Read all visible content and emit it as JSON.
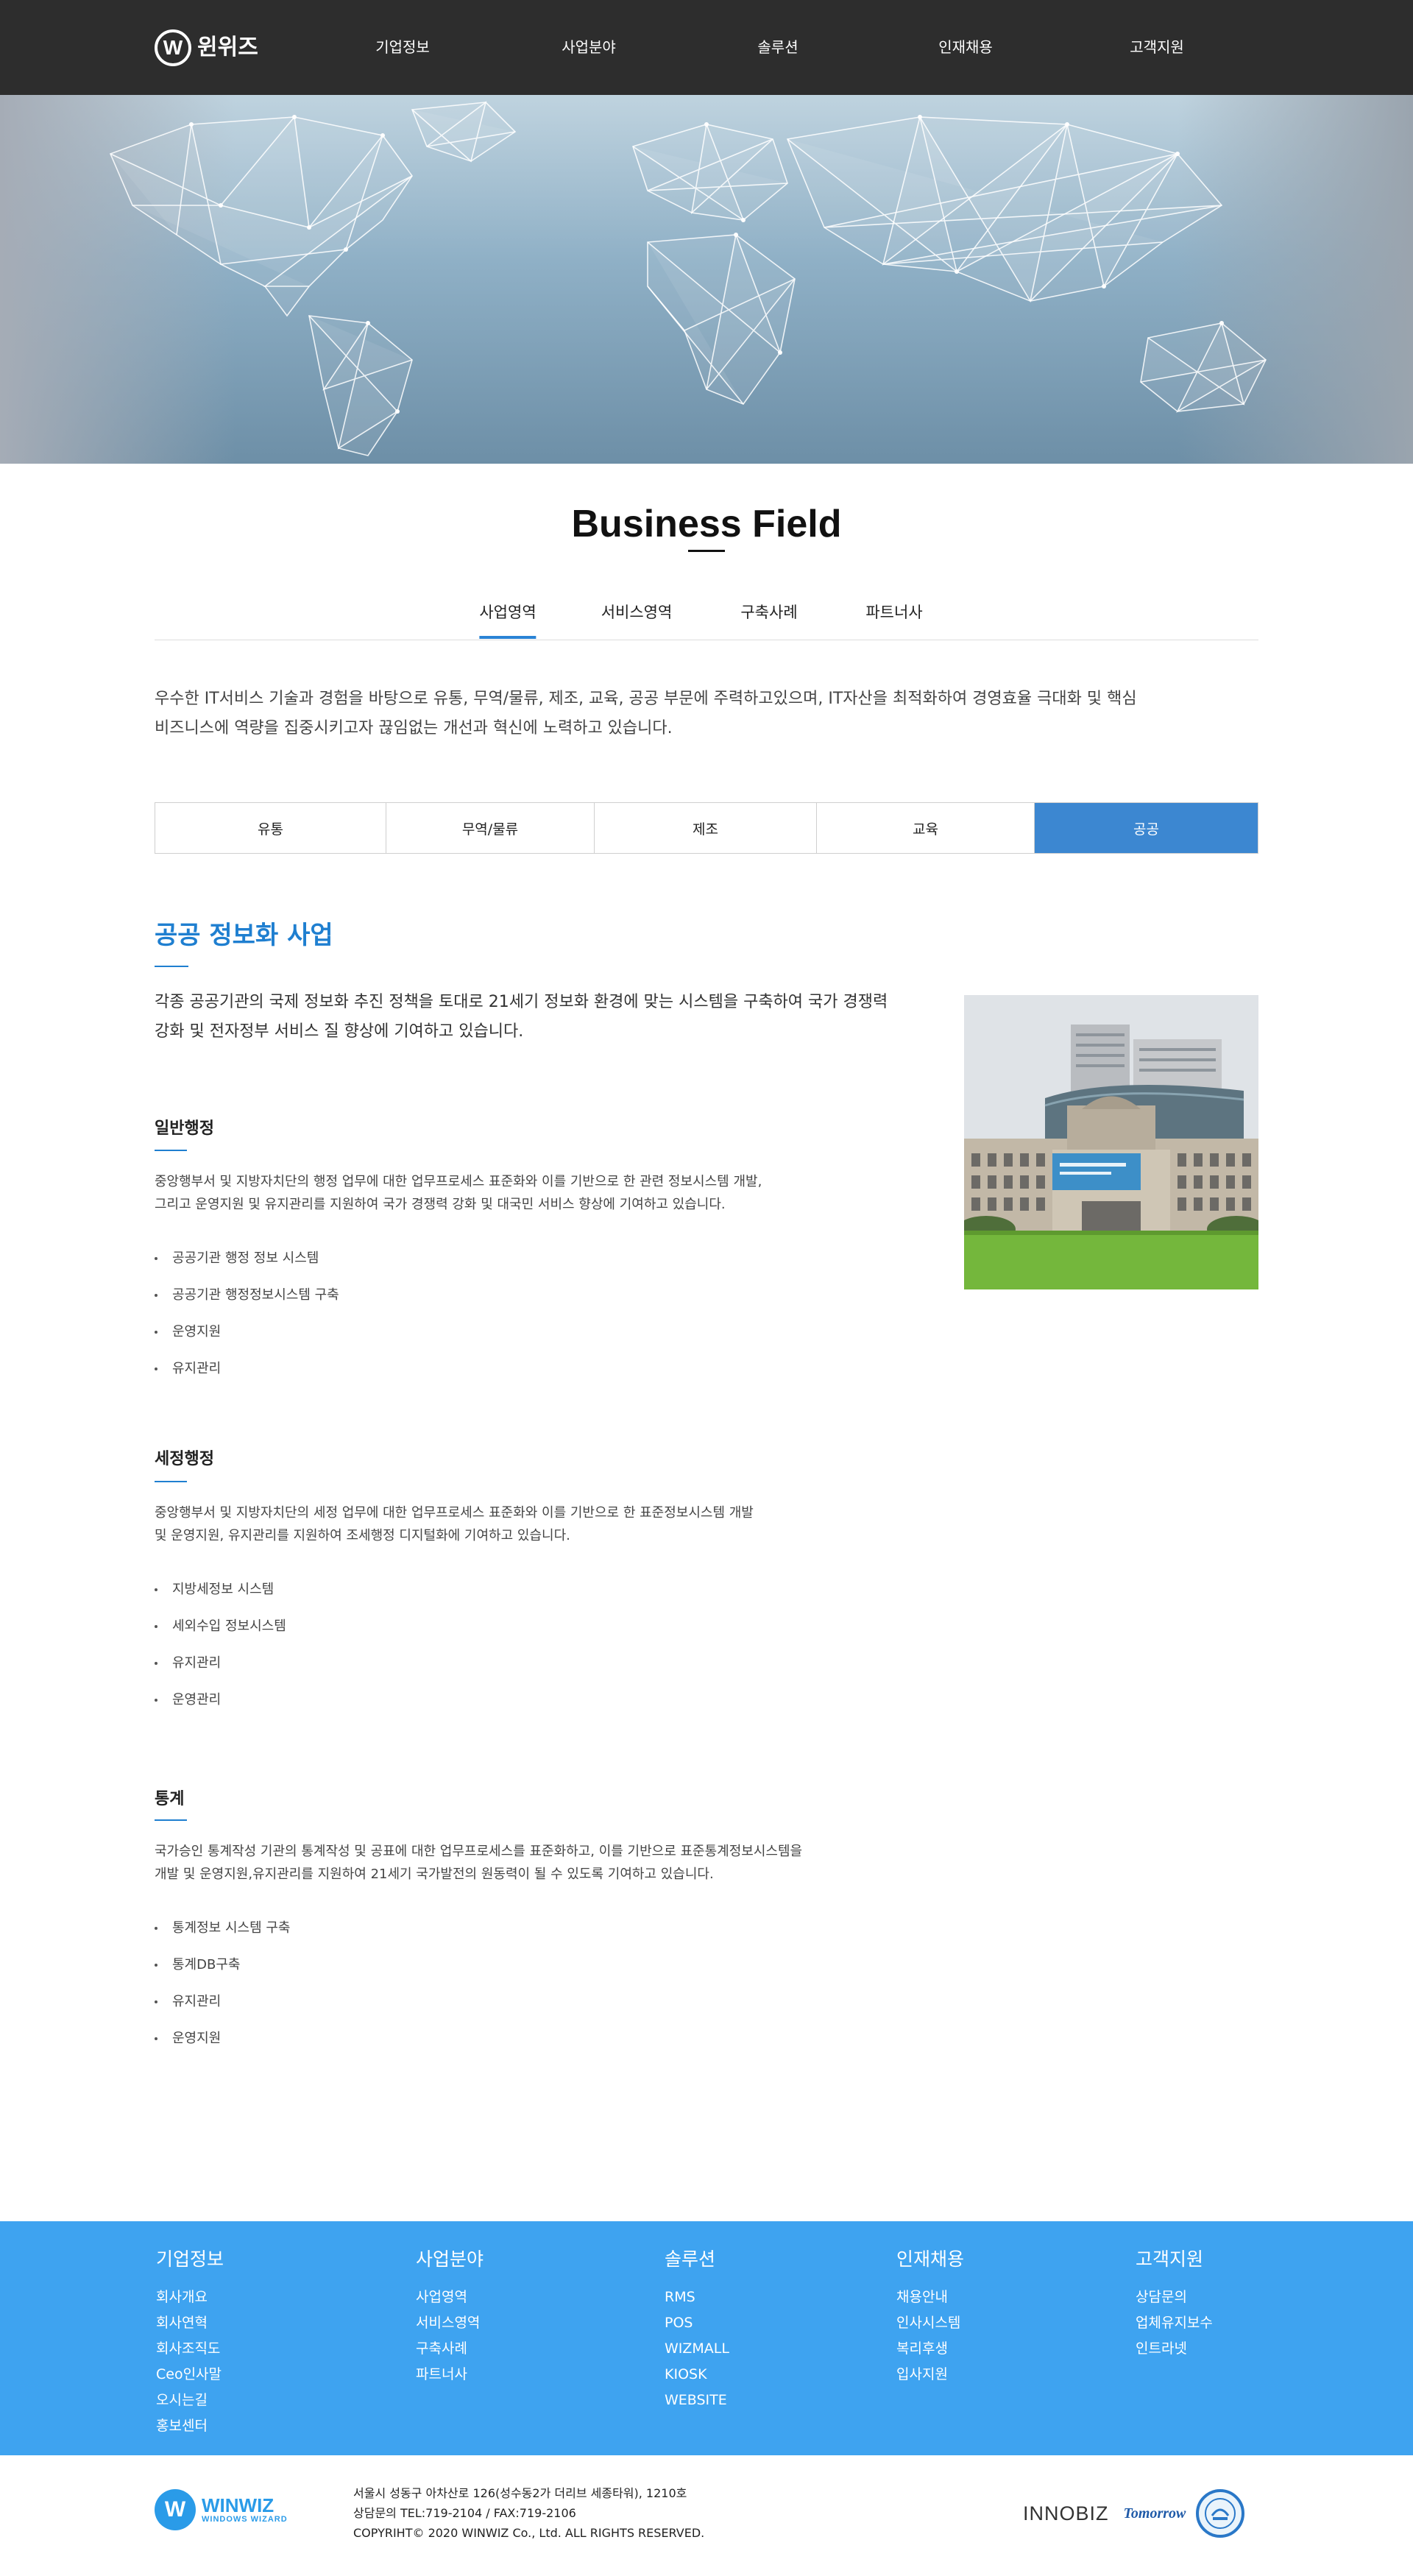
{
  "header": {
    "logo_text": "윈위즈",
    "logo_letter": "W",
    "nav": [
      "기업정보",
      "사업분야",
      "솔루션",
      "인재채용",
      "고객지원"
    ]
  },
  "page": {
    "title": "Business Field",
    "tabs": [
      "사업영역",
      "서비스영역",
      "구축사례",
      "파트너사"
    ],
    "active_tab": "사업영역",
    "intro_line1": "우수한 IT서비스 기술과 경험을 바탕으로 유통, 무역/물류, 제조, 교육, 공공 부문에 주력하고있으며, IT자산을 최적화하여 경영효율 극대화 및 핵심",
    "intro_line2": "비즈니스에 역량을 집중시키고자 끊임없는 개선과 혁신에 노력하고 있습니다."
  },
  "categories": [
    "유통",
    "무역/물류",
    "제조",
    "교육",
    "공공"
  ],
  "active_category": "공공",
  "section": {
    "title": "공공 정보화 사업",
    "desc_line1": "각종 공공기관의 국제 정보화 추진 정책을 토대로 21세기 정보화 환경에 맞는 시스템을 구축하여 국가 경쟁력",
    "desc_line2": "강화 및 전자정부 서비스 질 향상에 기여하고 있습니다.",
    "blocks": [
      {
        "title": "일반행정",
        "desc_line1": "중앙행부서 및 지방자치단의 행정 업무에 대한 업무프로세스 표준화와 이를 기반으로 한 관련 정보시스템 개발,",
        "desc_line2": "그리고 운영지원 및 유지관리를 지원하여 국가 경쟁력 강화 및 대국민 서비스 향상에 기여하고 있습니다.",
        "items": [
          "공공기관 행정 정보 시스템",
          "공공기관  행정정보시스템 구축",
          "운영지원",
          "유지관리"
        ]
      },
      {
        "title": "세정행정",
        "desc_line1": "중앙행부서 및 지방자치단의 세정 업무에 대한 업무프로세스 표준화와 이를 기반으로 한 표준정보시스템 개발",
        "desc_line2": "및 운영지원, 유지관리를  지원하여 조세행정 디지털화에 기여하고 있습니다.",
        "items": [
          "지방세정보 시스템",
          "세외수입 정보시스템",
          "유지관리",
          "운영관리"
        ]
      },
      {
        "title": "통계",
        "desc_line1": "국가승인 통계작성 기관의 통계작성 및 공표에 대한 업무프로세스를 표준화하고, 이를 기반으로 표준통계정보시스템을",
        "desc_line2": "개발 및 운영지원,유지관리를 지원하여 21세기 국가발전의 원동력이 될 수 있도록 기여하고 있습니다.",
        "items": [
          "통계정보 시스템 구축",
          "통계DB구축",
          "유지관리",
          "운영지원"
        ]
      }
    ]
  },
  "footer": {
    "columns": [
      {
        "head": "기업정보",
        "items": [
          "회사개요",
          "회사연혁",
          "회사조직도",
          "Ceo인사말",
          "오시는길",
          "홍보센터"
        ]
      },
      {
        "head": "사업분야",
        "items": [
          "사업영역",
          "서비스영역",
          "구축사례",
          "파트너사"
        ]
      },
      {
        "head": "솔루션",
        "items": [
          "RMS",
          "POS",
          "WIZMALL",
          "KIOSK",
          "WEBSITE"
        ]
      },
      {
        "head": "인재채용",
        "items": [
          "채용안내",
          "인사시스템",
          "복리후생",
          "입사지원"
        ]
      },
      {
        "head": "고객지원",
        "items": [
          "상담문의",
          "업체유지보수",
          "인트라넷"
        ]
      }
    ],
    "brand_name": "WINWIZ",
    "brand_sub": "WINDOWS WIZARD",
    "address": "서울시 성동구 아차산로 126(성수동2가 더리브 세종타워), 1210호",
    "contact": "상담문의 TEL:719-2104 / FAX:719-2106",
    "copyright": "COPYRIHT© 2020 WINWIZ Co., Ltd. ALL RIGHTS RESERVED.",
    "badge_innobiz": "INNOBIZ",
    "badge_venture": "Tomorrow"
  },
  "colors": {
    "header_bg": "#2d2d2d",
    "accent_blue": "#3c87d1",
    "title_blue": "#1f7fd0",
    "footer_blue": "#3ea3f0"
  }
}
